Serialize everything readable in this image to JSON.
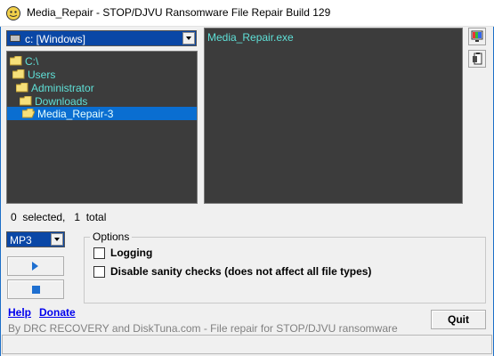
{
  "window": {
    "title": "Media_Repair - STOP/DJVU Ransomware File Repair Build 129"
  },
  "drive_selector": {
    "selected": "c: [Windows]"
  },
  "folder_tree": {
    "items": [
      {
        "label": "C:\\",
        "selected": false
      },
      {
        "label": "Users",
        "selected": false
      },
      {
        "label": "Administrator",
        "selected": false
      },
      {
        "label": "Downloads",
        "selected": false
      },
      {
        "label": "Media_Repair-3",
        "selected": true
      }
    ]
  },
  "file_list": {
    "items": [
      "Media_Repair.exe"
    ]
  },
  "status": {
    "text": "0  selected,   1  total"
  },
  "format_selector": {
    "selected": "MP3"
  },
  "options": {
    "legend": "Options",
    "logging_label": "Logging",
    "logging_checked": false,
    "sanity_label": "Disable sanity checks (does not affect all file types)",
    "sanity_checked": false
  },
  "links": {
    "help": "Help",
    "donate": "Donate"
  },
  "quit_label": "Quit",
  "footer": "By DRC RECOVERY and DiskTuna.com - File repair for STOP/DJVU ransomware",
  "icons": {
    "app": "app-icon",
    "drive": "drive-icon",
    "folder": "folder-icon",
    "play": "play-icon",
    "stop": "stop-icon",
    "monitor": "monitor-icon",
    "clipboard": "clipboard-icon"
  },
  "colors": {
    "panel_bg": "#3c3c3c",
    "panel_text": "#5fe0d7",
    "selection": "#0a6ed1",
    "select_bg": "#0a47a6",
    "accent_blue": "#1e6fd0"
  }
}
